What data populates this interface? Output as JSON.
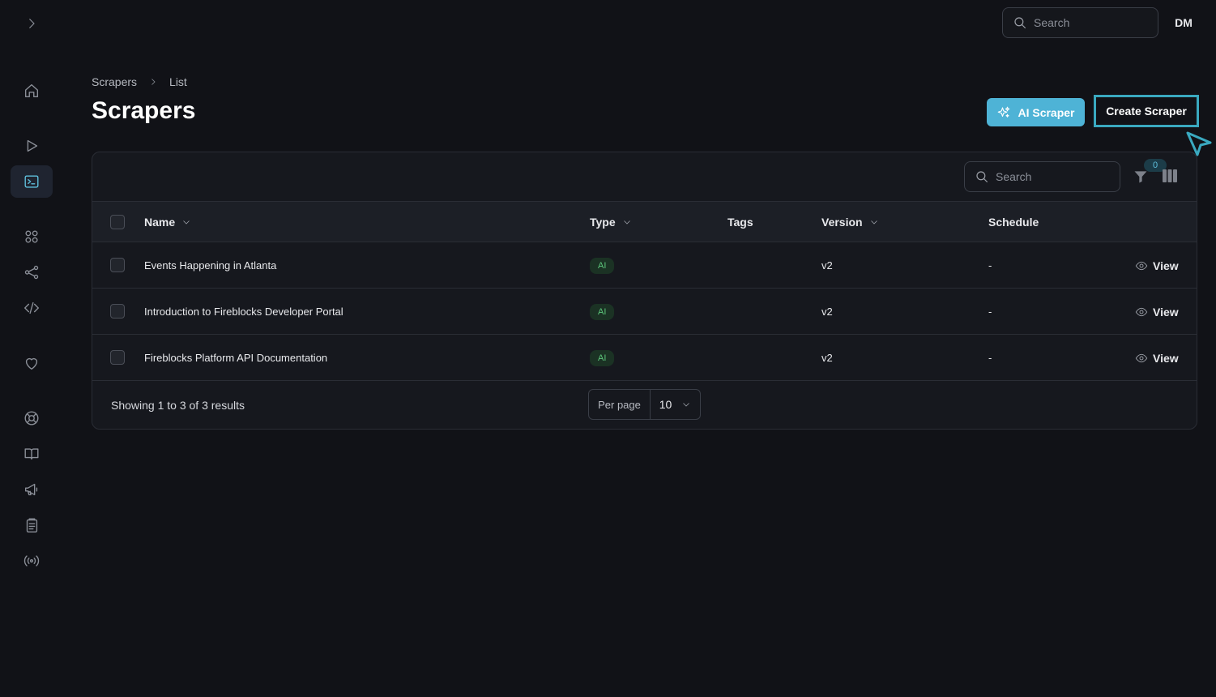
{
  "topbar": {
    "search_placeholder": "Search",
    "avatar_initials": "DM"
  },
  "sidebar": {
    "items": [
      {
        "icon": "home-icon"
      },
      {
        "icon": "play-icon"
      },
      {
        "icon": "terminal-icon",
        "active": true
      },
      {
        "icon": "grid-icon"
      },
      {
        "icon": "share-icon"
      },
      {
        "icon": "code-icon"
      },
      {
        "icon": "heart-icon"
      },
      {
        "icon": "lifebuoy-icon"
      },
      {
        "icon": "book-icon"
      },
      {
        "icon": "megaphone-icon"
      },
      {
        "icon": "clipboard-icon"
      },
      {
        "icon": "broadcast-icon"
      }
    ]
  },
  "breadcrumb": [
    "Scrapers",
    "List"
  ],
  "page": {
    "title": "Scrapers",
    "ai_button": "AI Scraper",
    "create_button": "Create Scraper"
  },
  "table": {
    "search_placeholder": "Search",
    "filter_count": "0",
    "columns": [
      "Name",
      "Type",
      "Tags",
      "Version",
      "Schedule"
    ],
    "rows": [
      {
        "name": "Events Happening in Atlanta",
        "type": "AI",
        "tags": "",
        "version": "v2",
        "schedule": "-",
        "action": "View"
      },
      {
        "name": "Introduction to Fireblocks Developer Portal",
        "type": "AI",
        "tags": "",
        "version": "v2",
        "schedule": "-",
        "action": "View"
      },
      {
        "name": "Fireblocks Platform API Documentation",
        "type": "AI",
        "tags": "",
        "version": "v2",
        "schedule": "-",
        "action": "View"
      }
    ],
    "footer": {
      "showing": "Showing 1 to 3 of 3 results",
      "per_page_label": "Per page",
      "per_page_value": "10"
    }
  },
  "colors": {
    "background": "#111217",
    "accent": "#4eb3d6",
    "highlight": "#3aa9c0",
    "badge_green": "#5cc47a"
  }
}
